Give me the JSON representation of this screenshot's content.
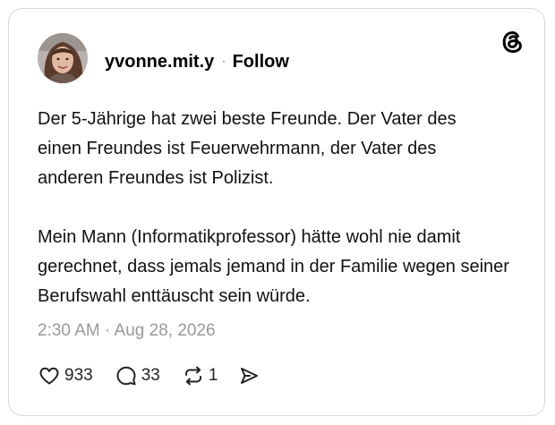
{
  "post": {
    "username": "yvonne.mit.y",
    "separator": "·",
    "follow_label": "Follow",
    "paragraphs": [
      "Der 5-Jährige hat zwei beste Freunde. Der Vater des einen Freundes ist Feuerwehrmann, der Vater des anderen Freundes ist Polizist.",
      "Mein Mann (Informatikprofessor) hätte wohl nie damit gerechnet, dass jemals jemand in der Familie wegen seiner Berufswahl enttäuscht sein würde."
    ],
    "timestamp": "2:30 AM · Aug 28, 2026"
  },
  "actions": {
    "likes": "933",
    "replies": "33",
    "reposts": "1"
  },
  "icons": {
    "brand": "threads-logo-icon",
    "like": "heart-icon",
    "reply": "speech-bubble-icon",
    "repost": "repost-arrows-icon",
    "share": "send-arrow-icon"
  },
  "colors": {
    "text": "#111111",
    "muted": "#999999",
    "border": "#d9d9d9"
  }
}
